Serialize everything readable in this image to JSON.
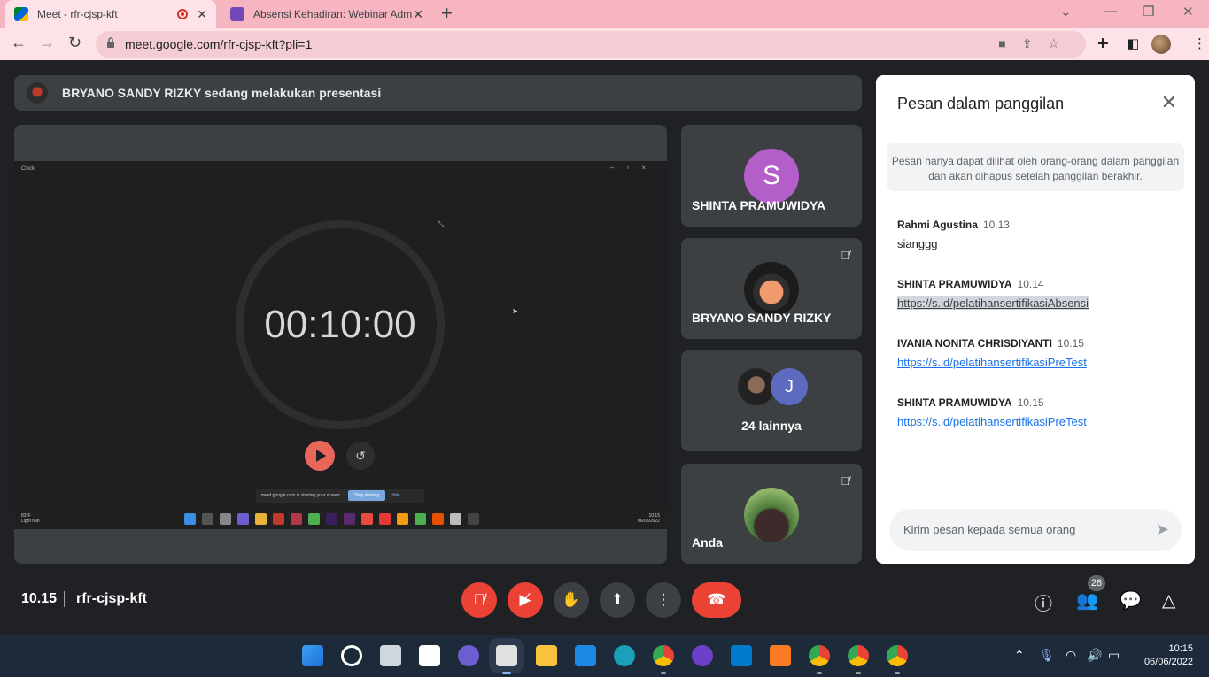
{
  "browser": {
    "tabs": [
      {
        "title": "Meet - rfr-cjsp-kft",
        "active": true,
        "recording": true
      },
      {
        "title": "Absensi Kehadiran: Webinar Adm",
        "active": false
      }
    ],
    "url": "meet.google.com/rfr-cjsp-kft?pli=1"
  },
  "meet": {
    "presenting_text": "BRYANO SANDY RIZKY sedang melakukan presentasi",
    "shared_screen": {
      "window_title": "Clock",
      "timer": "00:10:00",
      "share_notice": "meet.google.com is sharing your screen.",
      "stop_sharing": "Stop sharing",
      "hide": "Hide",
      "weather_temp": "83°F",
      "weather_desc": "Light rain",
      "time": "10.15",
      "date": "06/06/2022"
    },
    "tiles": [
      {
        "name": "SHINTA PRAMUWIDYA",
        "initial": "S"
      },
      {
        "name": "BRYANO SANDY RIZKY",
        "muted": true
      },
      {
        "name": "24 lainnya",
        "initial": "J"
      },
      {
        "name": "Anda",
        "muted": true
      }
    ],
    "time": "10.15",
    "meeting_code": "rfr-cjsp-kft",
    "participants_count": "28"
  },
  "chat": {
    "title": "Pesan dalam panggilan",
    "notice": "Pesan hanya dapat dilihat oleh orang-orang dalam panggilan dan akan dihapus setelah panggilan berakhir.",
    "messages": [
      {
        "sender": "Rahmi Agustina",
        "time": "10.13",
        "text": "sianggg"
      },
      {
        "sender": "SHINTA PRAMUWIDYA",
        "time": "10.14",
        "link": "https://s.id/pelatihansertifikasiAbsensi"
      },
      {
        "sender": "IVANIA NONITA CHRISDIYANTI",
        "time": "10.15",
        "link": "https://s.id/pelatihansertifikasiPreTest"
      },
      {
        "sender": "SHINTA PRAMUWIDYA",
        "time": "10.15",
        "link": "https://s.id/pelatihansertifikasiPreTest"
      }
    ],
    "input_placeholder": "Kirim pesan kepada semua orang"
  },
  "taskbar": {
    "time": "10:15",
    "date": "06/06/2022"
  }
}
